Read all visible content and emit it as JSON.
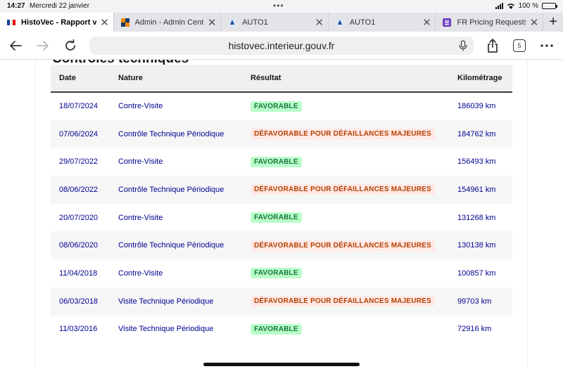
{
  "status_bar": {
    "time": "14:27",
    "date": "Mercredi 22 janvier",
    "battery": "100 %"
  },
  "tabs": [
    {
      "title": "HistoVec - Rapport ve",
      "icon": "french-flag-icon",
      "active": true
    },
    {
      "title": "Admin - Admin Center",
      "icon": "admin-center-icon",
      "active": false
    },
    {
      "title": "AUTO1",
      "icon": "auto1-icon",
      "active": false
    },
    {
      "title": "AUTO1",
      "icon": "auto1-icon",
      "active": false
    },
    {
      "title": "FR Pricing Requests",
      "icon": "pricing-requests-icon",
      "active": false
    }
  ],
  "toolbar": {
    "url": "histovec.interieur.gouv.fr",
    "tab_count": "5"
  },
  "section": {
    "title": "Contrôles techniques"
  },
  "table": {
    "headers": {
      "date": "Date",
      "nature": "Nature",
      "result": "Résultat",
      "mileage": "Kilométrage"
    },
    "rows": [
      {
        "date": "18/07/2024",
        "nature": "Contre-Visite",
        "result": "FAVORABLE",
        "status": "ok",
        "mileage": "186039 km"
      },
      {
        "date": "07/06/2024",
        "nature": "Contrôle Technique Périodique",
        "result": "DÉFAVORABLE POUR DÉFAILLANCES MAJEURES",
        "status": "ko",
        "mileage": "184762 km"
      },
      {
        "date": "29/07/2022",
        "nature": "Contre-Visite",
        "result": "FAVORABLE",
        "status": "ok",
        "mileage": "156493 km"
      },
      {
        "date": "08/06/2022",
        "nature": "Contrôle Technique Périodique",
        "result": "DÉFAVORABLE POUR DÉFAILLANCES MAJEURES",
        "status": "ko",
        "mileage": "154961 km"
      },
      {
        "date": "20/07/2020",
        "nature": "Contre-Visite",
        "result": "FAVORABLE",
        "status": "ok",
        "mileage": "131268 km"
      },
      {
        "date": "08/06/2020",
        "nature": "Contrôle Technique Périodique",
        "result": "DÉFAVORABLE POUR DÉFAILLANCES MAJEURES",
        "status": "ko",
        "mileage": "130138 km"
      },
      {
        "date": "11/04/2018",
        "nature": "Contre-Visite",
        "result": "FAVORABLE",
        "status": "ok",
        "mileage": "100857 km"
      },
      {
        "date": "06/03/2018",
        "nature": "Visite Technique Périodique",
        "result": "DÉFAVORABLE POUR DÉFAILLANCES MAJEURES",
        "status": "ko",
        "mileage": "99703 km"
      },
      {
        "date": "11/03/2016",
        "nature": "Visite Technique Périodique",
        "result": "FAVORABLE",
        "status": "ok",
        "mileage": "72916 km"
      }
    ]
  },
  "colors": {
    "link_blue": "#000091",
    "favorable_bg": "#b8fec9",
    "favorable_text": "#18753c",
    "defavorable_bg": "#ffe9e6",
    "defavorable_text": "#b34000"
  }
}
